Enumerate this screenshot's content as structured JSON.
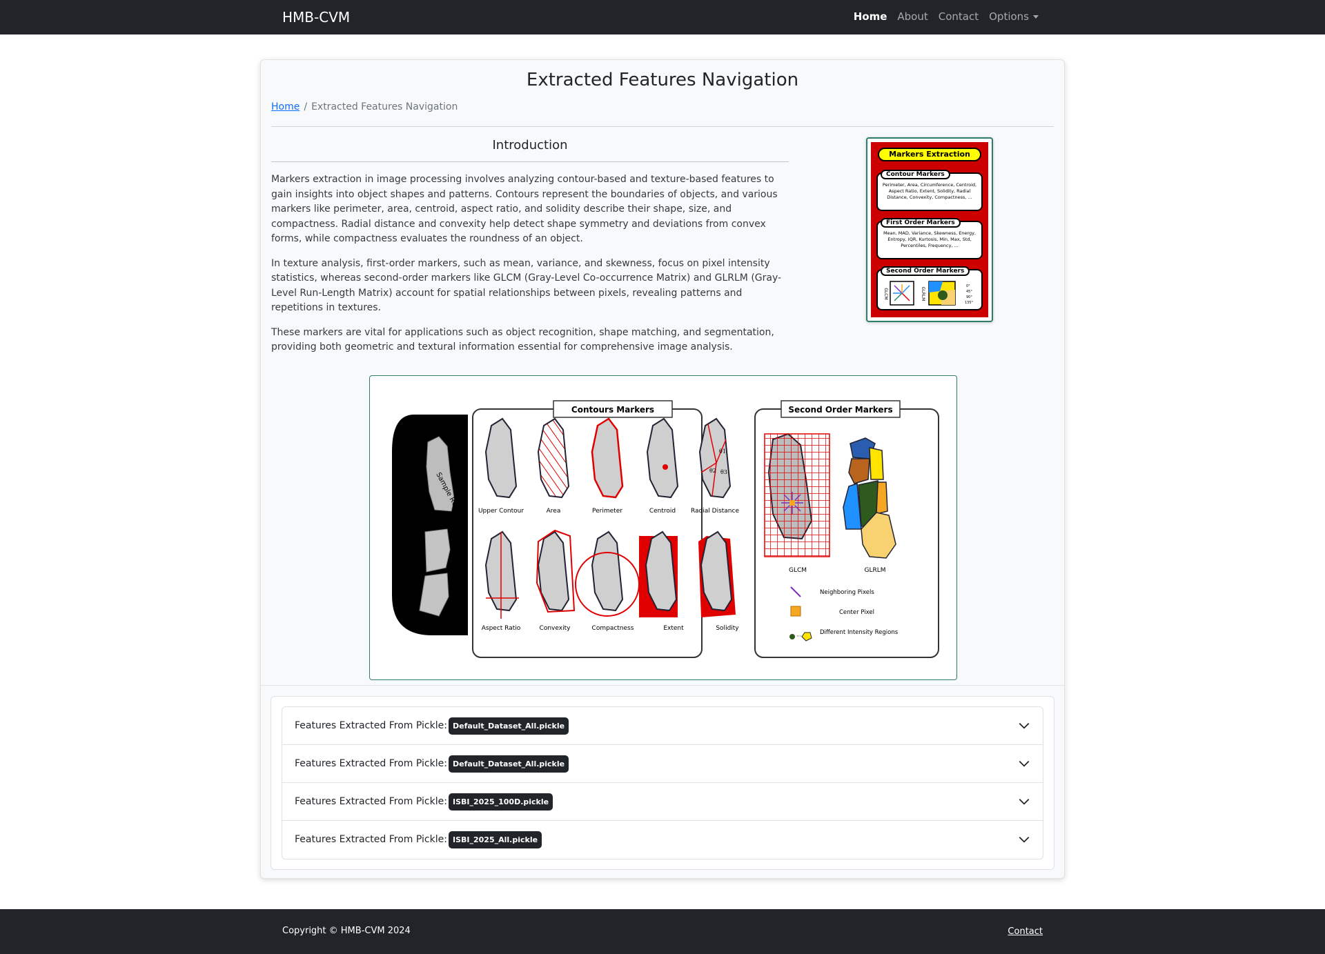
{
  "navbar": {
    "brand": "HMB-CVM",
    "links": [
      {
        "label": "Home"
      },
      {
        "label": "About"
      },
      {
        "label": "Contact"
      },
      {
        "label": "Options"
      }
    ]
  },
  "page": {
    "title": "Extracted Features Navigation",
    "breadcrumb": {
      "home": "Home",
      "separator": "/",
      "current": "Extracted Features Navigation"
    }
  },
  "intro": {
    "heading": "Introduction",
    "paragraphs": [
      "Markers extraction in image processing involves analyzing contour-based and texture-based features to gain insights into object shapes and patterns. Contours represent the boundaries of objects, and various markers like perimeter, area, centroid, aspect ratio, and solidity describe their shape, size, and compactness. Radial distance and convexity help detect shape symmetry and deviations from convex forms, while compactness evaluates the roundness of an object.",
      "In texture analysis, first-order markers, such as mean, variance, and skewness, focus on pixel intensity statistics, whereas second-order markers like GLCM (Gray-Level Co-occurrence Matrix) and GLRLM (Gray-Level Run-Length Matrix) account for spatial relationships between pixels, revealing patterns and repetitions in textures.",
      "These markers are vital for applications such as object recognition, shape matching, and segmentation, providing both geometric and textural information essential for comprehensive image analysis."
    ]
  },
  "poster": {
    "title": "Markers Extraction",
    "sections": [
      {
        "title": "Contour Markers",
        "text": "Perimeter, Area, Circumference, Centroid, Aspect Ratio, Extent, Solidity, Radial Distance, Convexity, Compactness, ..."
      },
      {
        "title": "First Order Markers",
        "text": "Mean, MAD, Variance, Skewness, Energy, Entropy, IQR, Kurtosis, Min, Max, Std, Percentiles, Frequency, ..."
      },
      {
        "title": "Second Order Markers",
        "text": ""
      }
    ],
    "glcm_label": "GLCM",
    "glrlm_label": "GLRLM",
    "angles": [
      "0°",
      "45°",
      "90°",
      "135°"
    ]
  },
  "figure": {
    "roi_label": "Sample ROI",
    "contours_title": "Contours Markers",
    "second_order_title": "Second Order Markers",
    "contour_labels_row1": [
      "Upper Contour",
      "Area",
      "Perimeter",
      "Centroid",
      "Radial Distance"
    ],
    "contour_labels_row2": [
      "Aspect Ratio",
      "Convexity",
      "Compactness",
      "Extent",
      "Solidity"
    ],
    "theta_labels": [
      "θ1",
      "θ2",
      "θ3"
    ],
    "glcm_label": "GLCM",
    "glrlm_label": "GLRLM",
    "legend": [
      "Neighboring Pixels",
      "Center Pixel",
      "Different Intensity Regions"
    ],
    "colors": {
      "red": "#e00000",
      "orange": "#f5a623",
      "purple": "#7b2fbf",
      "green": "#2e5a1e",
      "blue": "#1e90ff",
      "yellow": "#ffe400",
      "brown": "#b8641c",
      "navy": "#2a5db0",
      "sand": "#f8d270"
    }
  },
  "accordion": {
    "prefix": "Features Extracted From Pickle:",
    "items": [
      {
        "badge": "Default_Dataset_All.pickle"
      },
      {
        "badge": "Default_Dataset_All.pickle"
      },
      {
        "badge": "ISBI_2025_100D.pickle"
      },
      {
        "badge": "ISBI_2025_All.pickle"
      }
    ]
  },
  "footer": {
    "copyright": "Copyright © HMB-CVM 2024",
    "contact": "Contact"
  }
}
